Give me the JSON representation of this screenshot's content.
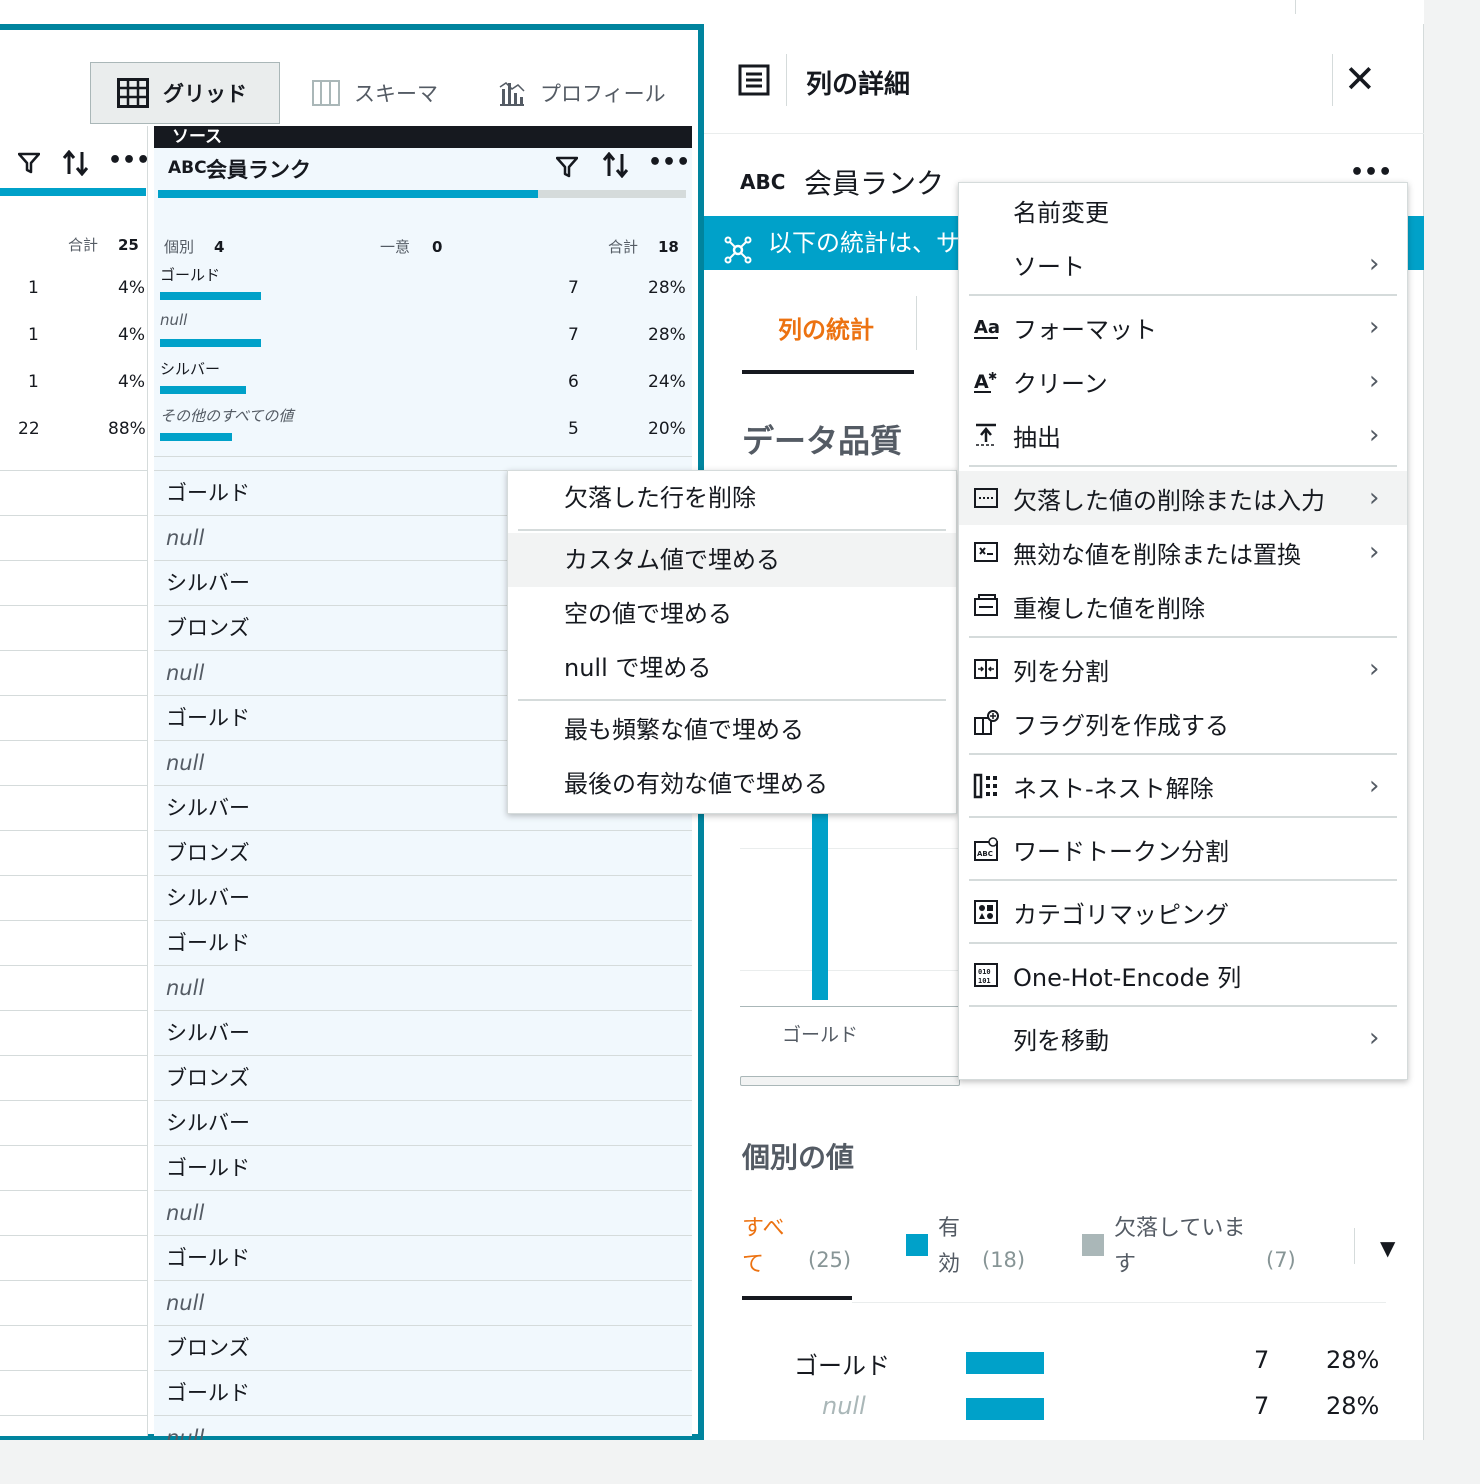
{
  "view_tabs": {
    "grid": "グリッド",
    "schema": "スキーマ",
    "profile": "プロフィール"
  },
  "left_column": {
    "total_label": "合計",
    "total_value": "25",
    "rows": [
      {
        "count": "1",
        "pct": "4%"
      },
      {
        "count": "1",
        "pct": "4%"
      },
      {
        "count": "1",
        "pct": "4%"
      },
      {
        "count": "22",
        "pct": "88%"
      }
    ]
  },
  "source_column": {
    "band": "ソース",
    "type": "ABC",
    "name": "会員ランク",
    "quality_fraction": 0.72,
    "distinct_label": "個別",
    "distinct_value": "4",
    "unique_label": "一意",
    "unique_value": "0",
    "total_label": "合計",
    "total_value": "18",
    "top_values": [
      {
        "label": "ゴールド",
        "count": "7",
        "pct": "28%",
        "fraction": 0.28,
        "italic": false
      },
      {
        "label": "null",
        "count": "7",
        "pct": "28%",
        "fraction": 0.28,
        "italic": true
      },
      {
        "label": "シルバー",
        "count": "6",
        "pct": "24%",
        "fraction": 0.24,
        "italic": false
      },
      {
        "label": "その他のすべての値",
        "count": "5",
        "pct": "20%",
        "fraction": 0.2,
        "italic": true
      }
    ],
    "cells": [
      "ゴールド",
      "null",
      "シルバー",
      "ブロンズ",
      "null",
      "ゴールド",
      "null",
      "シルバー",
      "ブロンズ",
      "シルバー",
      "ゴールド",
      "null",
      "シルバー",
      "ブロンズ",
      "シルバー",
      "ゴールド",
      "null",
      "ゴールド",
      "null",
      "ブロンズ",
      "ゴールド",
      "null"
    ]
  },
  "detail": {
    "title": "列の詳細",
    "close": "✕",
    "column_type": "ABC",
    "column_name": "会員ランク",
    "more": "•••",
    "info_text": "以下の統計は、サ",
    "stats_tab": "列の統計",
    "data_quality_title": "データ品質",
    "chart_label": "ゴールド",
    "distinct_values_title": "個別の値",
    "filters": {
      "all_label_1": "すべ",
      "all_label_2": "て",
      "all_count": "(25)",
      "valid_label_1": "有",
      "valid_label_2": "効",
      "valid_count": "(18)",
      "missing_label_1": "欠落していま",
      "missing_label_2": "す",
      "missing_count": "(7)"
    },
    "distinct_rows": [
      {
        "label": "ゴールド",
        "count": "7",
        "pct": "28%",
        "italic": false
      },
      {
        "label": "null",
        "count": "7",
        "pct": "28%",
        "italic": true
      }
    ]
  },
  "main_menu": [
    {
      "label": "名前変更",
      "icon": "none",
      "arrow": false
    },
    {
      "label": "ソート",
      "icon": "none",
      "arrow": true
    },
    {
      "label": "フォーマット",
      "icon": "format-icon",
      "arrow": true
    },
    {
      "label": "クリーン",
      "icon": "clean-icon",
      "arrow": true
    },
    {
      "label": "抽出",
      "icon": "extract-icon",
      "arrow": true
    },
    {
      "label": "欠落した値の削除または入力",
      "icon": "missing-icon",
      "arrow": true
    },
    {
      "label": "無効な値を削除または置換",
      "icon": "invalid-icon",
      "arrow": true
    },
    {
      "label": "重複した値を削除",
      "icon": "duplicate-icon",
      "arrow": false
    },
    {
      "label": "列を分割",
      "icon": "split-icon",
      "arrow": true
    },
    {
      "label": "フラグ列を作成する",
      "icon": "flag-icon",
      "arrow": false
    },
    {
      "label": "ネスト-ネスト解除",
      "icon": "nest-icon",
      "arrow": true
    },
    {
      "label": "ワードトークン分割",
      "icon": "token-icon",
      "arrow": false
    },
    {
      "label": "カテゴリマッピング",
      "icon": "category-icon",
      "arrow": false
    },
    {
      "label": "One-Hot-Encode 列",
      "icon": "onehot-icon",
      "arrow": false
    },
    {
      "label": "列を移動",
      "icon": "none",
      "arrow": true
    }
  ],
  "sub_menu": [
    "欠落した行を削除",
    "カスタム値で埋める",
    "空の値で埋める",
    "null で埋める",
    "最も頻繁な値で埋める",
    "最後の有効な値で埋める"
  ],
  "colors": {
    "accent": "#00a1c9",
    "frame": "#00849e",
    "orange": "#ec7211",
    "missing": "#aab7b8"
  }
}
